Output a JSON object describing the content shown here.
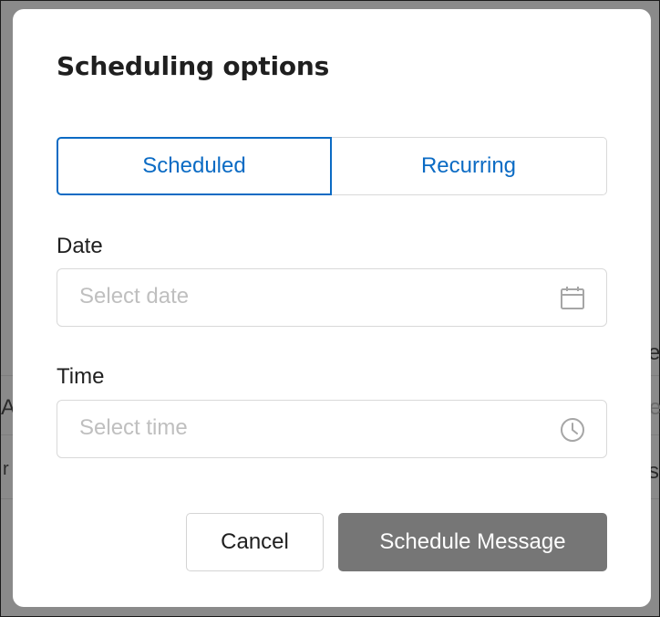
{
  "dialog": {
    "title": "Scheduling options",
    "tabs": [
      {
        "label": "Scheduled",
        "active": true
      },
      {
        "label": "Recurring",
        "active": false
      }
    ],
    "date": {
      "label": "Date",
      "placeholder": "Select date",
      "icon": "calendar-icon"
    },
    "time": {
      "label": "Time",
      "placeholder": "Select time",
      "icon": "clock-icon"
    },
    "buttons": {
      "cancel": "Cancel",
      "submit": "Schedule Message"
    }
  },
  "background": {
    "fragments": [
      "e",
      "Ac",
      "e",
      "r",
      "s"
    ]
  },
  "colors": {
    "accent": "#0b6bc4",
    "primary_button": "#767676",
    "placeholder": "#bfbfbf",
    "border": "#d9d9d9"
  }
}
